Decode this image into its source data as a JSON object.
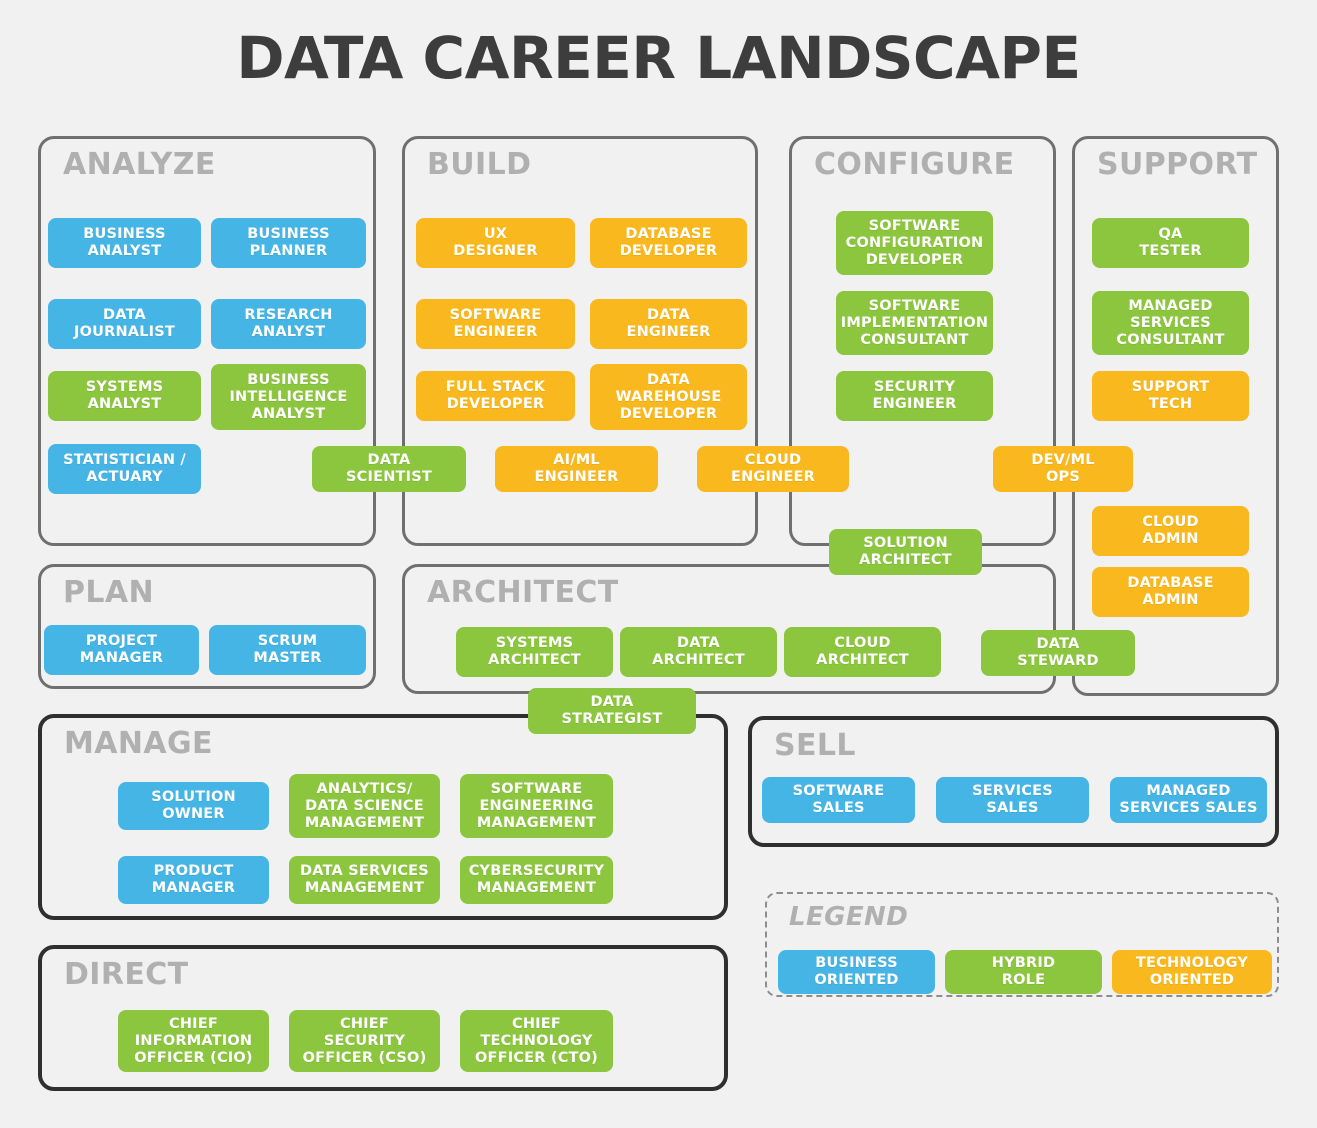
{
  "title": "DATA CAREER LANDSCAPE",
  "colors": {
    "business": "#45b5e6",
    "hybrid": "#8cc63f",
    "technology": "#f9b81e",
    "background": "#f1f1f1",
    "border": "#6f6f6f",
    "border_dark": "#2f2f2f",
    "group_label": "#b0b0b0",
    "title": "#3d3d3d"
  },
  "groups": {
    "analyze": {
      "label": "ANALYZE",
      "roles": [
        {
          "label": "BUSINESS\nANALYST",
          "type": "business"
        },
        {
          "label": "BUSINESS\nPLANNER",
          "type": "business"
        },
        {
          "label": "DATA\nJOURNALIST",
          "type": "business"
        },
        {
          "label": "RESEARCH\nANALYST",
          "type": "business"
        },
        {
          "label": "SYSTEMS\nANALYST",
          "type": "hybrid"
        },
        {
          "label": "BUSINESS\nINTELLIGENCE\nANALYST",
          "type": "hybrid"
        },
        {
          "label": "STATISTICIAN /\nACTUARY",
          "type": "business"
        }
      ]
    },
    "build": {
      "label": "BUILD",
      "roles": [
        {
          "label": "UX\nDESIGNER",
          "type": "technology"
        },
        {
          "label": "DATABASE\nDEVELOPER",
          "type": "technology"
        },
        {
          "label": "SOFTWARE\nENGINEER",
          "type": "technology"
        },
        {
          "label": "DATA\nENGINEER",
          "type": "technology"
        },
        {
          "label": "FULL STACK\nDEVELOPER",
          "type": "technology"
        },
        {
          "label": "DATA\nWAREHOUSE\nDEVELOPER",
          "type": "technology"
        }
      ]
    },
    "configure": {
      "label": "CONFIGURE",
      "roles": [
        {
          "label": "SOFTWARE\nCONFIGURATION\nDEVELOPER",
          "type": "hybrid"
        },
        {
          "label": "SOFTWARE\nIMPLEMENTATION\nCONSULTANT",
          "type": "hybrid"
        },
        {
          "label": "SECURITY\nENGINEER",
          "type": "hybrid"
        }
      ]
    },
    "support": {
      "label": "SUPPORT",
      "roles": [
        {
          "label": "QA\nTESTER",
          "type": "hybrid"
        },
        {
          "label": "MANAGED\nSERVICES\nCONSULTANT",
          "type": "hybrid"
        },
        {
          "label": "SUPPORT\nTECH",
          "type": "technology"
        },
        {
          "label": "CLOUD\nADMIN",
          "type": "technology"
        },
        {
          "label": "DATABASE\nADMIN",
          "type": "technology"
        }
      ]
    },
    "plan": {
      "label": "PLAN",
      "roles": [
        {
          "label": "PROJECT\nMANAGER",
          "type": "business"
        },
        {
          "label": "SCRUM\nMASTER",
          "type": "business"
        }
      ]
    },
    "architect": {
      "label": "ARCHITECT",
      "roles": [
        {
          "label": "SYSTEMS\nARCHITECT",
          "type": "hybrid"
        },
        {
          "label": "DATA\nARCHITECT",
          "type": "hybrid"
        },
        {
          "label": "CLOUD\nARCHITECT",
          "type": "hybrid"
        }
      ]
    },
    "manage": {
      "label": "MANAGE",
      "roles": [
        {
          "label": "SOLUTION\nOWNER",
          "type": "business"
        },
        {
          "label": "ANALYTICS/\nDATA SCIENCE\nMANAGEMENT",
          "type": "hybrid"
        },
        {
          "label": "SOFTWARE\nENGINEERING\nMANAGEMENT",
          "type": "hybrid"
        },
        {
          "label": "PRODUCT\nMANAGER",
          "type": "business"
        },
        {
          "label": "DATA SERVICES\nMANAGEMENT",
          "type": "hybrid"
        },
        {
          "label": "CYBERSECURITY\nMANAGEMENT",
          "type": "hybrid"
        }
      ]
    },
    "sell": {
      "label": "SELL",
      "roles": [
        {
          "label": "SOFTWARE\nSALES",
          "type": "business"
        },
        {
          "label": "SERVICES\nSALES",
          "type": "business"
        },
        {
          "label": "MANAGED\nSERVICES SALES",
          "type": "business"
        }
      ]
    },
    "direct": {
      "label": "DIRECT",
      "roles": [
        {
          "label": "CHIEF\nINFORMATION\nOFFICER (CIO)",
          "type": "hybrid"
        },
        {
          "label": "CHIEF\nSECURITY\nOFFICER (CSO)",
          "type": "hybrid"
        },
        {
          "label": "CHIEF\nTECHNOLOGY\nOFFICER (CTO)",
          "type": "hybrid"
        }
      ]
    },
    "legend": {
      "label": "LEGEND",
      "roles": [
        {
          "label": "BUSINESS\nORIENTED",
          "type": "business"
        },
        {
          "label": "HYBRID\nROLE",
          "type": "hybrid"
        },
        {
          "label": "TECHNOLOGY\nORIENTED",
          "type": "technology"
        }
      ]
    }
  },
  "straddling_roles": [
    {
      "label": "DATA\nSCIENTIST",
      "type": "hybrid",
      "spans": [
        "analyze",
        "build"
      ]
    },
    {
      "label": "AI/ML\nENGINEER",
      "type": "technology",
      "spans": [
        "build"
      ]
    },
    {
      "label": "CLOUD\nENGINEER",
      "type": "technology",
      "spans": [
        "build",
        "configure"
      ]
    },
    {
      "label": "DEV/ML\nOPS",
      "type": "technology",
      "spans": [
        "configure",
        "support"
      ]
    },
    {
      "label": "SOLUTION\nARCHITECT",
      "type": "hybrid",
      "spans": [
        "configure",
        "architect"
      ]
    },
    {
      "label": "DATA\nSTEWARD",
      "type": "hybrid",
      "spans": [
        "architect",
        "support"
      ]
    },
    {
      "label": "DATA\nSTRATEGIST",
      "type": "hybrid",
      "spans": [
        "architect",
        "manage"
      ]
    }
  ]
}
